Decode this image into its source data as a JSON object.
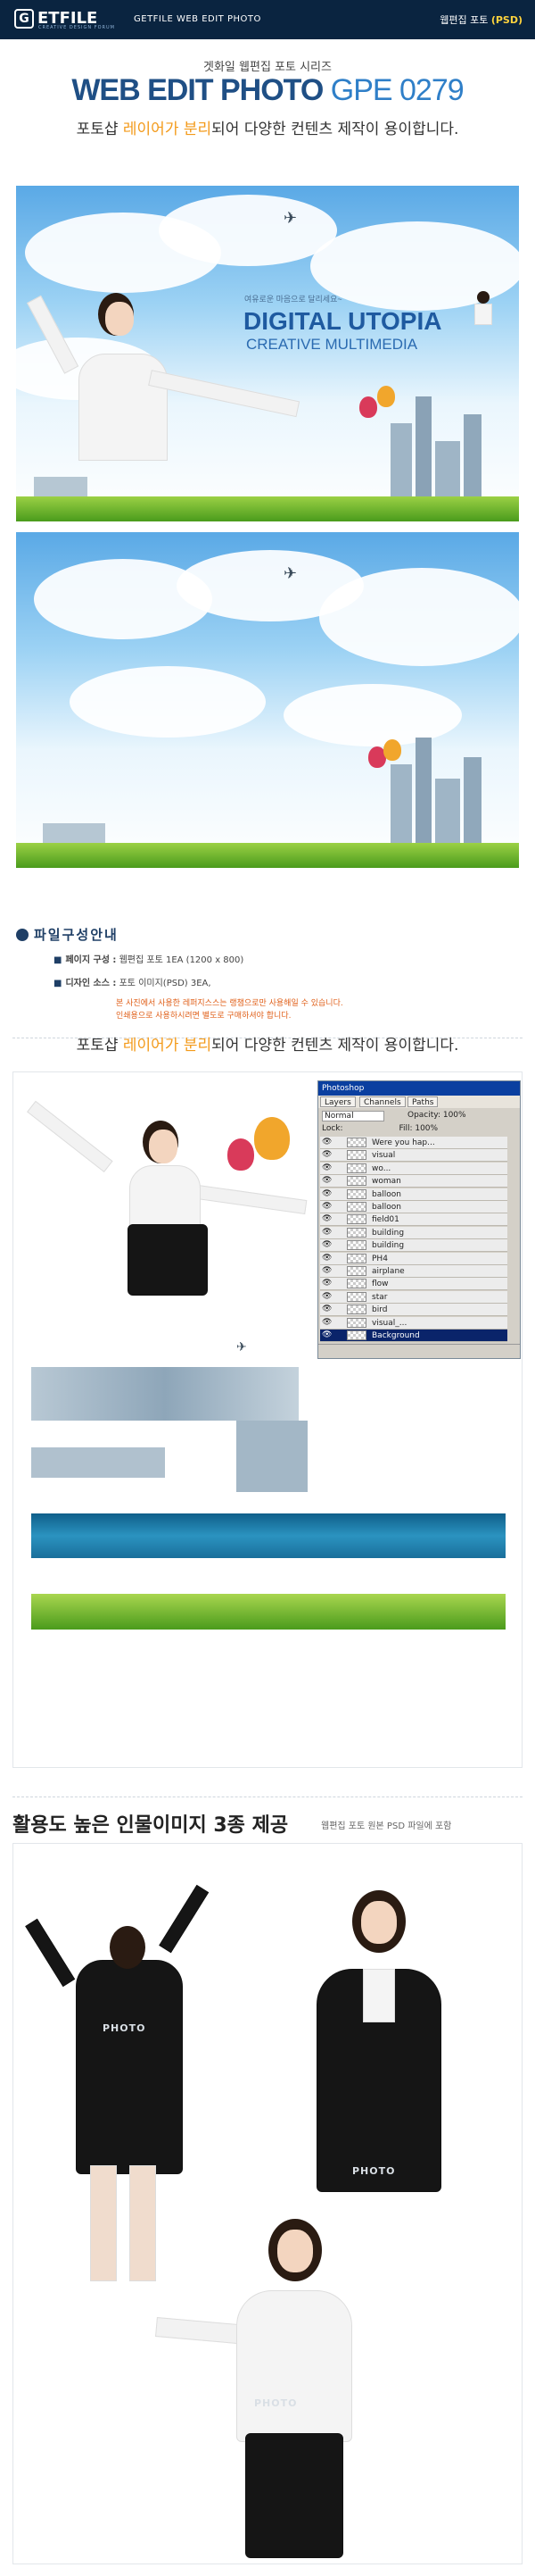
{
  "header": {
    "logo": "ETFILE",
    "logo_mark": "G",
    "logo_tagline": "CREATIVE DESIGN FORUM",
    "site_title": "GETFILE WEB EDIT PHOTO",
    "category_prefix": "웹편집 포토",
    "category_suffix": "(PSD)"
  },
  "hero": {
    "series": "겟화일 웹편집 포토 시리즈",
    "title": "WEB EDIT PHOTO",
    "code": "GPE 0279",
    "tagline_pre": "포토샵 ",
    "tagline_hl": "레이어가 분리",
    "tagline_post": "되어 다양한 컨텐츠 제작이 용이합니다."
  },
  "banner": {
    "slogan": "여유로운 마음으로 달리세요~",
    "line1": "DIGITAL UTOPIA",
    "line2": "CREATIVE MULTIMEDIA"
  },
  "info": {
    "heading": "파일구성안내",
    "rows": [
      {
        "label": "페이지 구성 :",
        "value": "웹편집 포토 1EA (1200 x 800)"
      },
      {
        "label": "디자인 소스 :",
        "value": "포토 이미지(PSD) 3EA,"
      }
    ],
    "warn1": "본 사진에서 사용한 레퍼지스스는 랭챔으로만 사용해일 수 있습니다.",
    "warn2": "인쇄용으로 사용하시려면 별도로 구매하셔야 합니다."
  },
  "section2": {
    "tagline_pre": "포토샵 ",
    "tagline_hl": "레이어가 분리",
    "tagline_post": "되어 다양한 컨텐츠 제작이 용이합니다."
  },
  "layers_panel": {
    "tabs": [
      "Layers",
      "Channels",
      "Paths"
    ],
    "mode": "Normal",
    "opacity": "Opacity: 100%",
    "fill": "Fill: 100%",
    "lock": "Lock:",
    "items": [
      "Were you hap...",
      "visual",
      "wo...",
      "woman",
      "balloon",
      "balloon",
      "field01",
      "building",
      "building",
      "PH4",
      "airplane",
      "flow",
      "star",
      "bird",
      "visual_...",
      "Background"
    ]
  },
  "section3": {
    "title": "활용도 높은 인물이미지 3종 제공",
    "note": "웹편집 포토 원본 PSD 파일에 포함"
  },
  "watermark": "PHOTO",
  "colors": {
    "header_bg": "#0a2440",
    "title_blue": "#1f4f85",
    "highlight": "#f39a1a",
    "warn": "#e0601a"
  }
}
